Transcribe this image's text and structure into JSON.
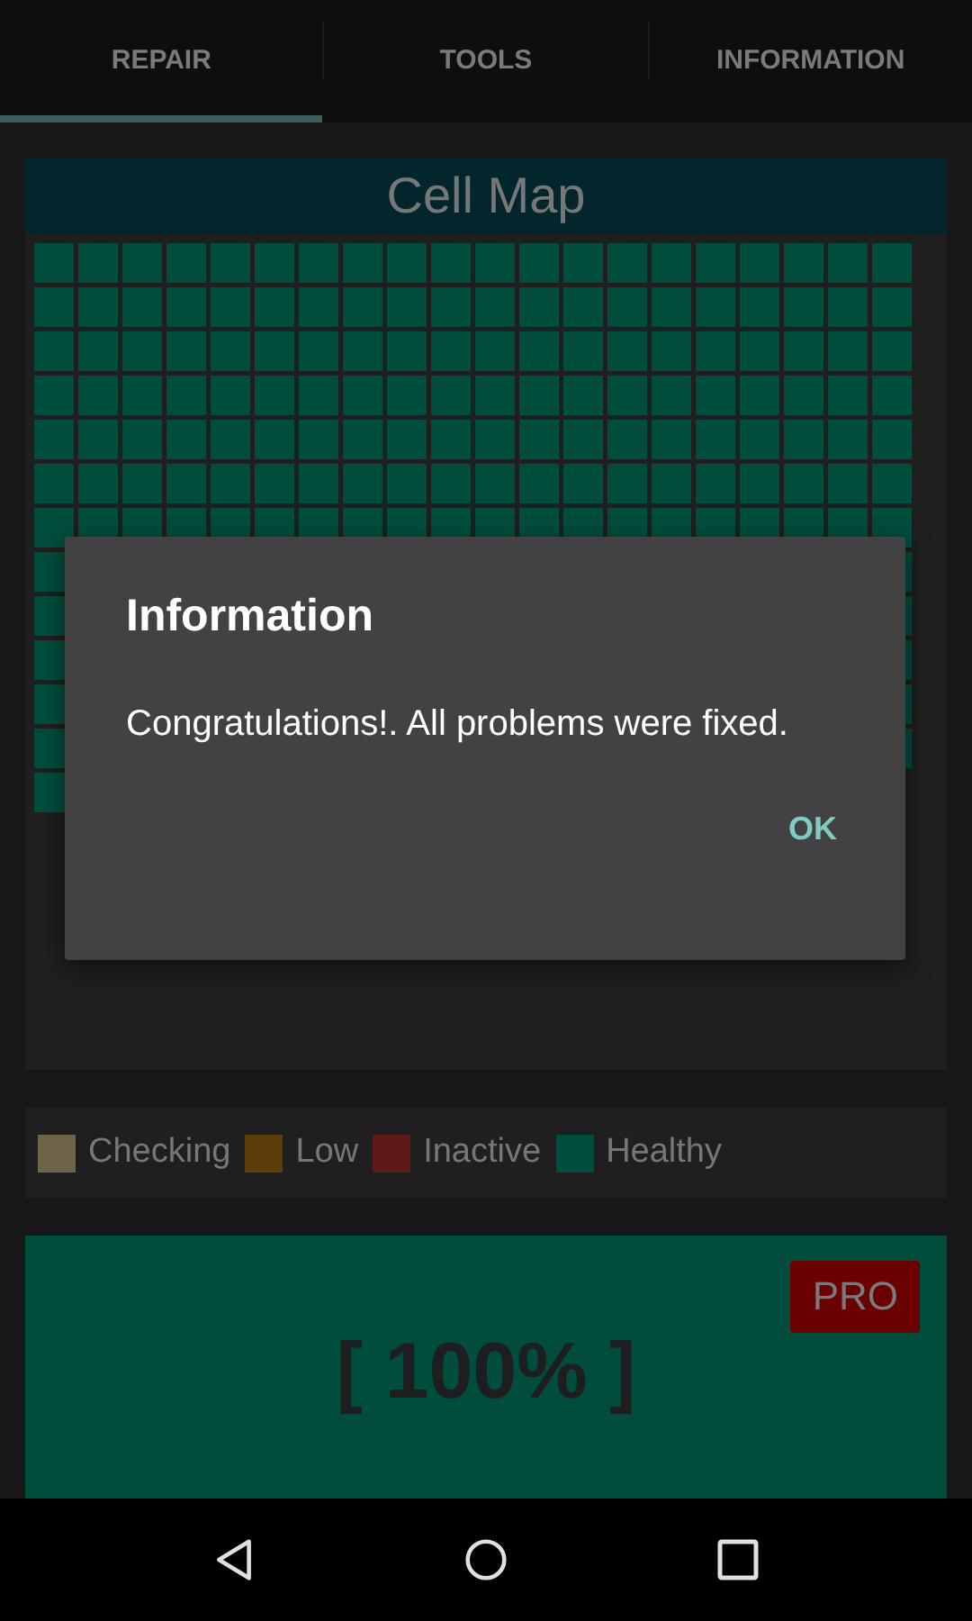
{
  "tabs": [
    {
      "label": "REPAIR",
      "selected": true
    },
    {
      "label": "TOOLS",
      "selected": false
    },
    {
      "label": "INFORMATION",
      "selected": false
    }
  ],
  "cell_map": {
    "title": "Cell Map",
    "all_healthy": true
  },
  "legend": [
    {
      "kind": "checking",
      "label": "Checking",
      "color": "#6e6548"
    },
    {
      "kind": "low",
      "label": "Low",
      "color": "#5e3b0a"
    },
    {
      "kind": "inactive",
      "label": "Inactive",
      "color": "#5e1a17"
    },
    {
      "kind": "healthy",
      "label": "Healthy",
      "color": "#004d3d"
    }
  ],
  "progress": {
    "text": "[ 100% ]",
    "badge": "PRO"
  },
  "dialog": {
    "title": "Information",
    "message": "Congratulations!. All problems were fixed.",
    "button": "OK"
  }
}
